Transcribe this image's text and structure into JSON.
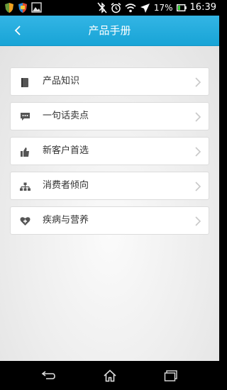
{
  "status_bar": {
    "battery_percent": "17%",
    "time": "16:39"
  },
  "header": {
    "title": "产品手册"
  },
  "menu": {
    "items": [
      {
        "label": "产品知识",
        "icon": "book-icon"
      },
      {
        "label": "一句话卖点",
        "icon": "speech-bubble-icon"
      },
      {
        "label": "新客户首选",
        "icon": "thumbs-up-icon"
      },
      {
        "label": "消费者倾向",
        "icon": "hierarchy-icon"
      },
      {
        "label": "疾病与营养",
        "icon": "heart-plus-icon"
      }
    ]
  },
  "colors": {
    "accent": "#33b5e5",
    "icon": "#555555",
    "chevron": "#c8c8c8"
  }
}
